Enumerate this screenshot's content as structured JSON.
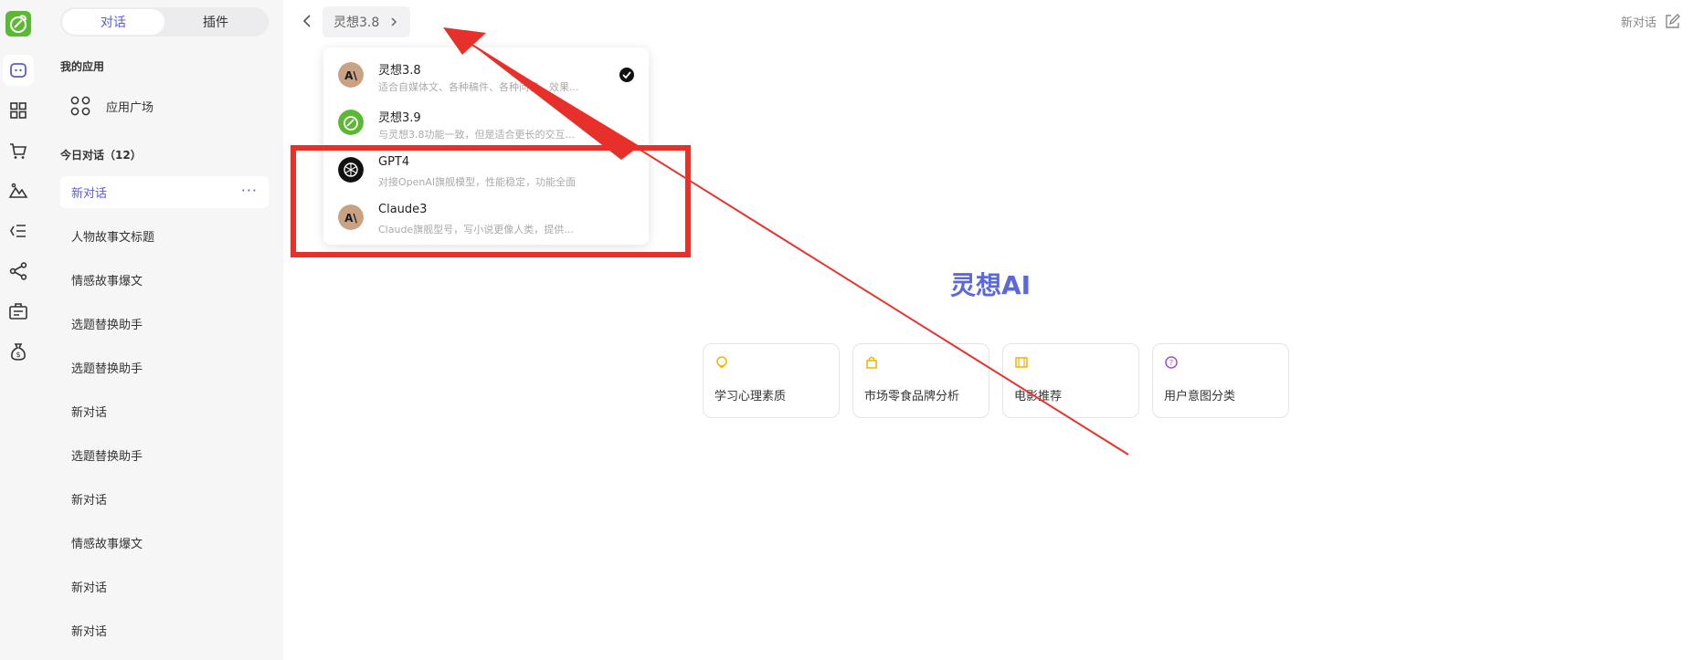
{
  "sidebar": {
    "tabs": [
      {
        "label": "对话",
        "active": true
      },
      {
        "label": "插件",
        "active": false
      }
    ],
    "my_apps_title": "我的应用",
    "app_entry": "应用广场",
    "today_title": "今日对话（12）",
    "conversations": [
      {
        "label": "新对话",
        "active": true
      },
      {
        "label": "人物故事文标题"
      },
      {
        "label": "情感故事爆文"
      },
      {
        "label": "选题替换助手"
      },
      {
        "label": "选题替换助手"
      },
      {
        "label": "新对话"
      },
      {
        "label": "选题替换助手"
      },
      {
        "label": "新对话"
      },
      {
        "label": "情感故事爆文"
      },
      {
        "label": "新对话"
      },
      {
        "label": "新对话"
      }
    ],
    "more_label": "···"
  },
  "header": {
    "model_selected": "灵想3.8",
    "new_chat_label": "新对话"
  },
  "model_menu": [
    {
      "name": "灵想3.8",
      "desc": "适合自媒体文、各种稿件、各种问答，效果...",
      "avatar": "claude-avatar",
      "selected": true
    },
    {
      "name": "灵想3.9",
      "desc": "与灵想3.8功能一致，但是适合更长的交互...",
      "avatar": "lingxiang-avatar",
      "selected": false
    },
    {
      "name": "GPT4",
      "desc": "对接OpenAI旗舰模型，性能稳定，功能全面",
      "avatar": "openai-avatar",
      "selected": false
    },
    {
      "name": "Claude3",
      "desc": "Claude旗舰型号，写小说更像人类，提供...",
      "avatar": "claude-avatar",
      "selected": false
    }
  ],
  "main": {
    "brand": "灵想AI",
    "suggestions": [
      {
        "label": "学习心理素质",
        "icon": "lightbulb-icon",
        "color": "#f0b400"
      },
      {
        "label": "市场零食品牌分析",
        "icon": "bag-icon",
        "color": "#f0b400"
      },
      {
        "label": "电影推荐",
        "icon": "film-icon",
        "color": "#f0b400"
      },
      {
        "label": "用户意图分类",
        "icon": "question-icon",
        "color": "#a04fd8"
      }
    ]
  },
  "colors": {
    "accent": "#5b5bdc",
    "brand": "#5b68dc",
    "annotation": "#e8302a",
    "logo_green": "#5bb832"
  }
}
